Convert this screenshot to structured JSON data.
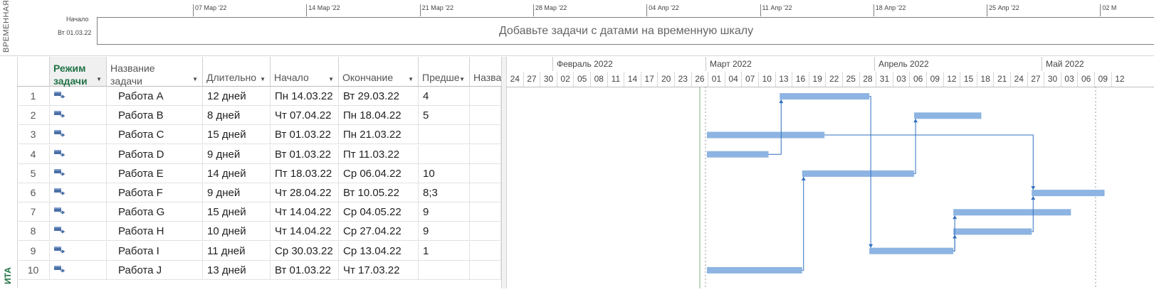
{
  "timeline": {
    "side_label": "ВРЕМЕННАЯ",
    "start_label": "Начало",
    "start_date": "Вт 01.03.22",
    "placeholder": "Добавьте задачи с датами на временную шкалу",
    "ticks": [
      "07 Мар '22",
      "14 Мар '22",
      "21 Мар '22",
      "28 Мар '22",
      "04 Апр '22",
      "11 Апр '22",
      "18 Апр '22",
      "25 Апр '22",
      "02 М"
    ]
  },
  "left_strip_label": "ИТА",
  "columns": {
    "mode": "Режим задачи",
    "name": "Название задачи",
    "duration": "Длительно",
    "start": "Начало",
    "finish": "Окончание",
    "pred": "Предше",
    "extra": "Назва"
  },
  "tasks": [
    {
      "id": "1",
      "name": "Работа A",
      "duration": "12 дней",
      "start": "Пн 14.03.22",
      "finish": "Вт 29.03.22",
      "pred": "4"
    },
    {
      "id": "2",
      "name": "Работа B",
      "duration": "8 дней",
      "start": "Чт 07.04.22",
      "finish": "Пн 18.04.22",
      "pred": "5"
    },
    {
      "id": "3",
      "name": "Работа C",
      "duration": "15 дней",
      "start": "Вт 01.03.22",
      "finish": "Пн 21.03.22",
      "pred": ""
    },
    {
      "id": "4",
      "name": "Работа D",
      "duration": "9 дней",
      "start": "Вт 01.03.22",
      "finish": "Пт 11.03.22",
      "pred": ""
    },
    {
      "id": "5",
      "name": "Работа E",
      "duration": "14 дней",
      "start": "Пт 18.03.22",
      "finish": "Ср 06.04.22",
      "pred": "10"
    },
    {
      "id": "6",
      "name": "Работа F",
      "duration": "9 дней",
      "start": "Чт 28.04.22",
      "finish": "Вт 10.05.22",
      "pred": "8;3"
    },
    {
      "id": "7",
      "name": "Работа G",
      "duration": "15 дней",
      "start": "Чт 14.04.22",
      "finish": "Ср 04.05.22",
      "pred": "9"
    },
    {
      "id": "8",
      "name": "Работа H",
      "duration": "10 дней",
      "start": "Чт 14.04.22",
      "finish": "Ср 27.04.22",
      "pred": "9"
    },
    {
      "id": "9",
      "name": "Работа I",
      "duration": "11 дней",
      "start": "Ср 30.03.22",
      "finish": "Ср 13.04.22",
      "pred": "1"
    },
    {
      "id": "10",
      "name": "Работа J",
      "duration": "13 дней",
      "start": "Вт 01.03.22",
      "finish": "Чт 17.03.22",
      "pred": ""
    }
  ],
  "gantt": {
    "months": [
      "Февраль 2022",
      "Март 2022",
      "Апрель 2022",
      "Май 2022"
    ],
    "days": [
      "24",
      "27",
      "30",
      "02",
      "05",
      "08",
      "11",
      "14",
      "17",
      "20",
      "23",
      "26",
      "01",
      "04",
      "07",
      "10",
      "13",
      "16",
      "19",
      "22",
      "25",
      "28",
      "31",
      "03",
      "06",
      "09",
      "12",
      "15",
      "18",
      "21",
      "24",
      "27",
      "30",
      "03",
      "06",
      "09",
      "12"
    ],
    "bar_color": "#8db4e2",
    "link_color": "#2f6fbf"
  }
}
